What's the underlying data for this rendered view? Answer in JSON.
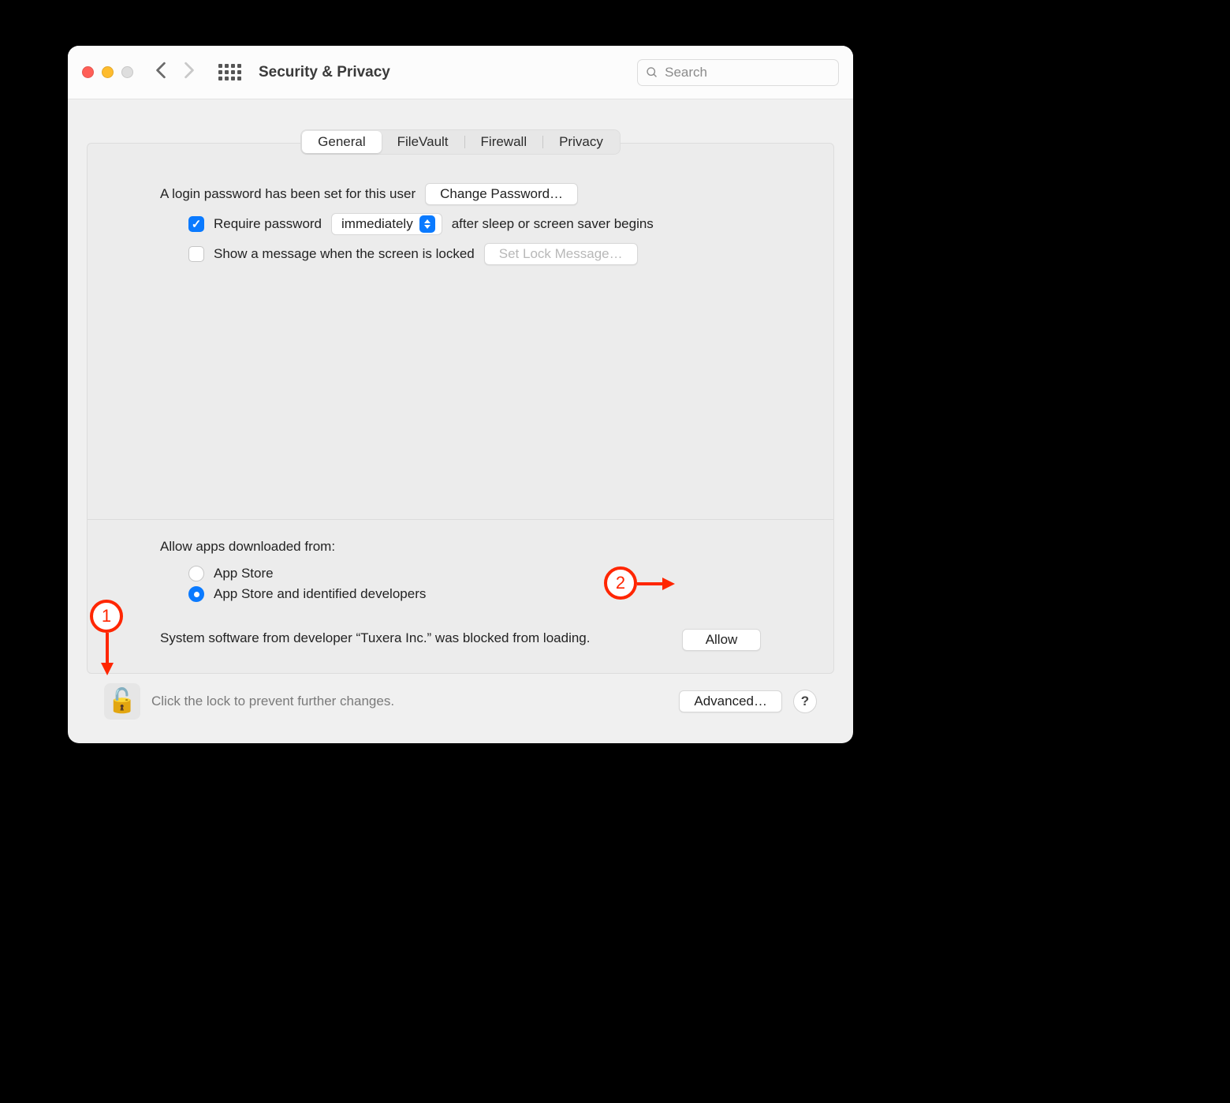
{
  "title": "Security & Privacy",
  "search": {
    "placeholder": "Search"
  },
  "tabs": {
    "general": "General",
    "filevault": "FileVault",
    "firewall": "Firewall",
    "privacy": "Privacy"
  },
  "login": {
    "password_set": "A login password has been set for this user",
    "change_password_btn": "Change Password…",
    "require_pw_label": "Require password",
    "require_pw_delay": "immediately",
    "require_pw_suffix": "after sleep or screen saver begins",
    "show_message_label": "Show a message when the screen is locked",
    "set_lock_msg_btn": "Set Lock Message…"
  },
  "gatekeeper": {
    "allow_label": "Allow apps downloaded from:",
    "opt_appstore": "App Store",
    "opt_identified": "App Store and identified developers",
    "blocked_text": "System software from developer “Tuxera Inc.” was blocked from loading.",
    "allow_btn": "Allow"
  },
  "footer": {
    "lock_text": "Click the lock to prevent further changes.",
    "advanced_btn": "Advanced…",
    "help": "?"
  },
  "annotations": {
    "one": "1",
    "two": "2"
  }
}
